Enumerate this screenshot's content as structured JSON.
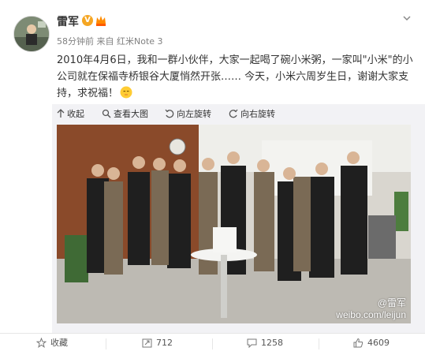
{
  "user": {
    "name": "雷军",
    "verified_badge": "V",
    "time": "58分钟前",
    "source_prefix": "来自",
    "source": "红米Note 3"
  },
  "post": {
    "text": "2010年4月6日，我和一群小伙伴，大家一起喝了碗小米粥，一家叫\"小米\"的小公司就在保福寺桥银谷大厦悄然开张…… 今天，小米六周岁生日，谢谢大家支持，求祝福！"
  },
  "toolbar": {
    "collapse": "收起",
    "view_large": "查看大图",
    "rotate_left": "向左旋转",
    "rotate_right": "向右旋转"
  },
  "photo": {
    "watermark_name": "@雷军",
    "watermark_url": "weibo.com/leijun"
  },
  "actions": {
    "favorite": "收藏",
    "repost_count": "712",
    "comment_count": "1258",
    "like_count": "4609"
  },
  "icons": {
    "chevron": "chevron-down-icon",
    "collapse": "arrow-up-icon",
    "view_large": "search-icon",
    "rotate_left": "rotate-left-icon",
    "rotate_right": "rotate-right-icon",
    "favorite": "star-icon",
    "repost": "repost-icon",
    "comment": "comment-icon",
    "like": "thumbs-up-icon"
  },
  "colors": {
    "verified": "#f5a623",
    "text": "#333333",
    "meta": "#808080"
  }
}
